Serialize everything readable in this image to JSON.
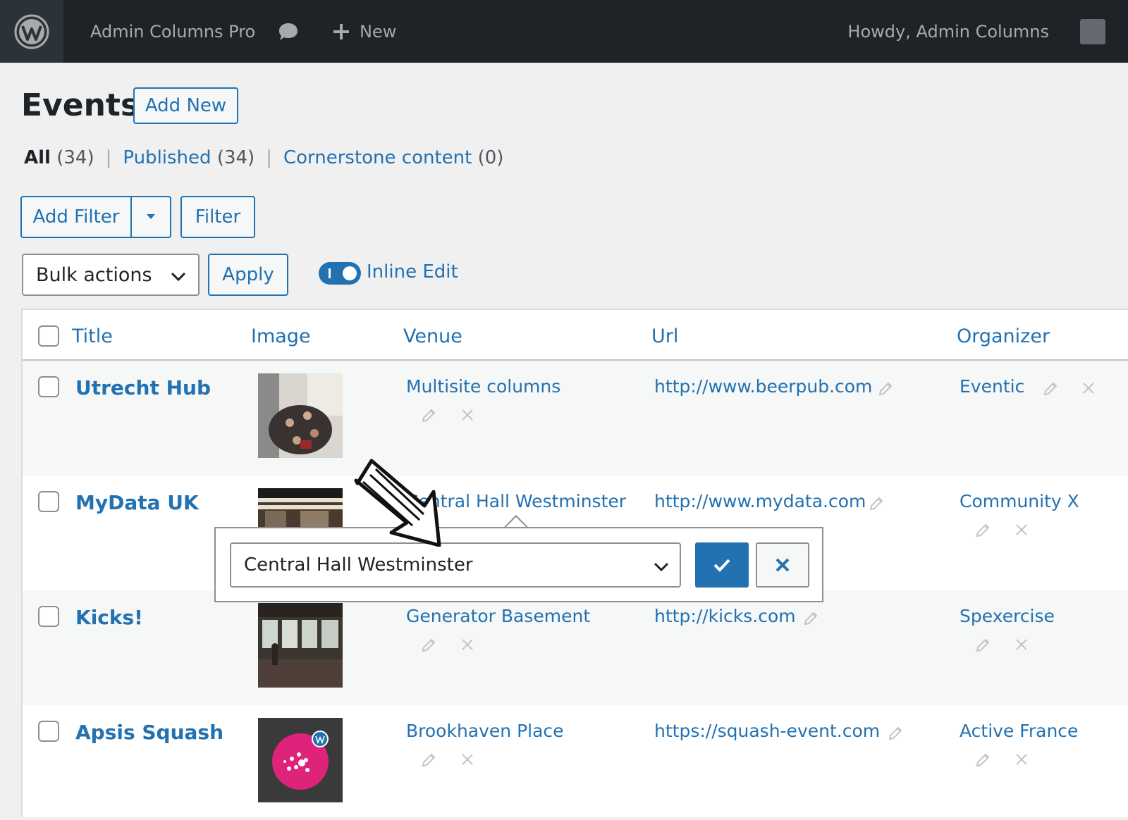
{
  "adminbar": {
    "site_name": "Admin Columns Pro",
    "new_label": "New",
    "howdy": "Howdy, Admin Columns"
  },
  "page": {
    "title": "Events",
    "add_new": "Add New"
  },
  "views": {
    "all_label": "All",
    "all_count": "(34)",
    "published_label": "Published",
    "published_count": "(34)",
    "cornerstone_label": "Cornerstone content",
    "cornerstone_count": "(0)"
  },
  "filters": {
    "add_filter": "Add Filter",
    "filter": "Filter"
  },
  "bulk": {
    "selected": "Bulk actions",
    "apply": "Apply"
  },
  "inline_edit": {
    "label": "Inline Edit",
    "enabled": true
  },
  "table": {
    "columns": [
      "Title",
      "Image",
      "Venue",
      "Url",
      "Organizer"
    ],
    "rows": [
      {
        "title": "Utrecht Hub",
        "venue": "Multisite columns",
        "url": "http://www.beerpub.com",
        "organizer": "Eventic"
      },
      {
        "title": "MyData UK",
        "venue": "Central Hall Westminster",
        "url": "http://www.mydata.com",
        "organizer": "Community X"
      },
      {
        "title": "Kicks!",
        "venue": "Generator Basement",
        "url": "http://kicks.com",
        "organizer": "Spexercise"
      },
      {
        "title": "Apsis Squash",
        "venue": "Brookhaven Place",
        "url": "https://squash-event.com",
        "organizer": "Active France"
      }
    ]
  },
  "popup": {
    "selected_value": "Central Hall Westminster"
  },
  "colors": {
    "accent": "#2271b1",
    "adminbar": "#1d2327",
    "background": "#f0f0f1"
  }
}
